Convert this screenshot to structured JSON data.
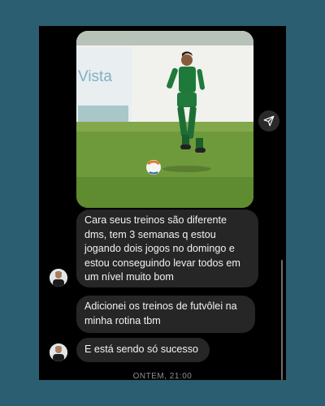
{
  "chat": {
    "messages": [
      {
        "text": "Cara seus treinos são diferente\ndms, tem 3 semanas q estou\njogando dois jogos no domingo e\nestou conseguindo levar todos em\num nível muito bom"
      },
      {
        "text": "Adicionei os treinos de futvôlei na\nminha rotina tbm"
      },
      {
        "text": "E está sendo só sucesso"
      }
    ],
    "photo_banner_text": "Vista",
    "timestamp": "ONTEM, 21:00"
  },
  "colors": {
    "background": "#2c5e72",
    "bubble": "#262626",
    "screen": "#000000",
    "text": "#f2f2f2"
  },
  "icons": {
    "share": "send-icon"
  }
}
